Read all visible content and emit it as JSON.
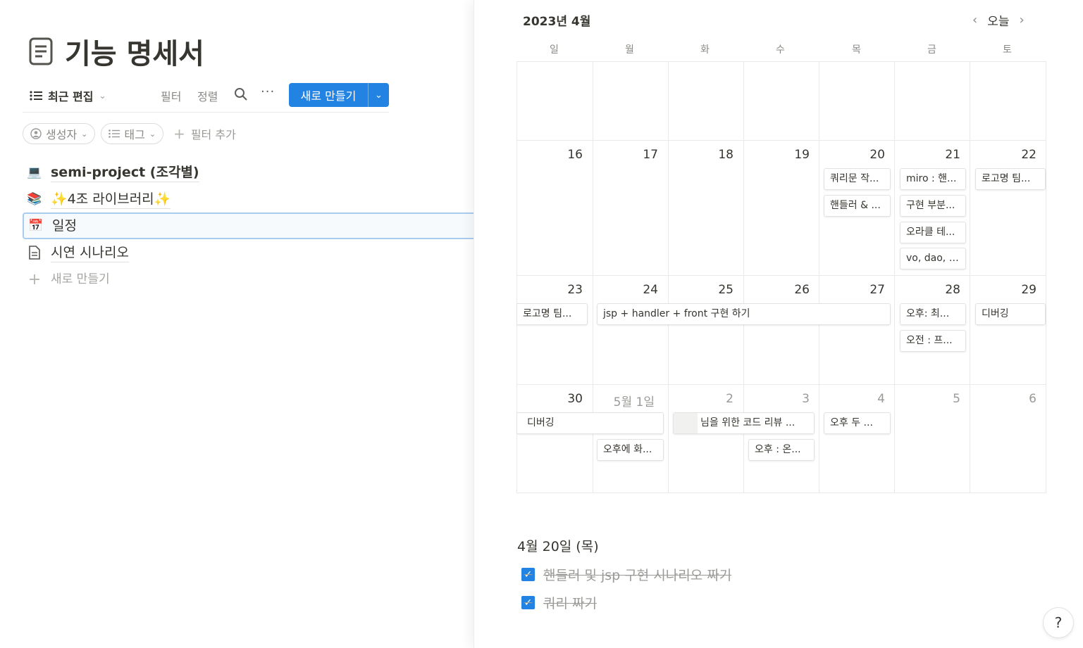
{
  "page": {
    "title": "기능 명세서"
  },
  "toolbar": {
    "view_label": "최근 편집",
    "filter_label": "필터",
    "sort_label": "정렬",
    "more_label": "···",
    "new_label": "새로 만들기"
  },
  "filters": {
    "creator": "생성자",
    "tag": "태그",
    "add_filter": "필터 추가"
  },
  "rows": [
    {
      "emoji": "💻",
      "label": "semi-project (조각별)"
    },
    {
      "emoji": "📚",
      "label": "✨4조 라이브러리✨"
    },
    {
      "emoji": "📅",
      "label": "일정"
    },
    {
      "emoji": "",
      "label": "시연 시나리오"
    }
  ],
  "new_row_label": "새로 만들기",
  "calendar": {
    "month_label": "2023년 4월",
    "today_label": "오늘",
    "weekdays": [
      "일",
      "월",
      "화",
      "수",
      "목",
      "금",
      "토"
    ],
    "week1": [
      "",
      "",
      "",
      "",
      "",
      "",
      ""
    ],
    "week2": [
      "16",
      "17",
      "18",
      "19",
      "20",
      "21",
      "22"
    ],
    "week3": [
      "23",
      "24",
      "25",
      "26",
      "27",
      "28",
      "29"
    ],
    "week4": [
      "30",
      "5월 1일",
      "2",
      "3",
      "4",
      "5",
      "6"
    ],
    "events": {
      "e1": "쿼리문 작...",
      "e2": "핸들러 & ...",
      "e3": "miro : 핸...",
      "e4": "구현 부분...",
      "e5": "오라클 테...",
      "e6": "vo, dao, s...",
      "e7": "로고명 팀...",
      "e8": "로고명 팀...",
      "e9": "jsp + handler + front 구현 하기",
      "e10": "오후: 최...",
      "e11": "오전 : 프...",
      "e12": "디버깅",
      "e13": "디버깅",
      "e14": "오후에 화...",
      "e15": "님을 위한 코드 리뷰 ...",
      "e16": "오후 : 온...",
      "e17": "오후 두 ..."
    }
  },
  "selected_day": {
    "label": "4월 20일 (목)",
    "todos": [
      "핸들러 및 jsp 구현 시나리오 짜기",
      "쿼리 짜기"
    ]
  },
  "help_label": "?",
  "colors": {
    "accent": "#2383e2",
    "text": "#37352f",
    "muted": "#9b9a97"
  }
}
